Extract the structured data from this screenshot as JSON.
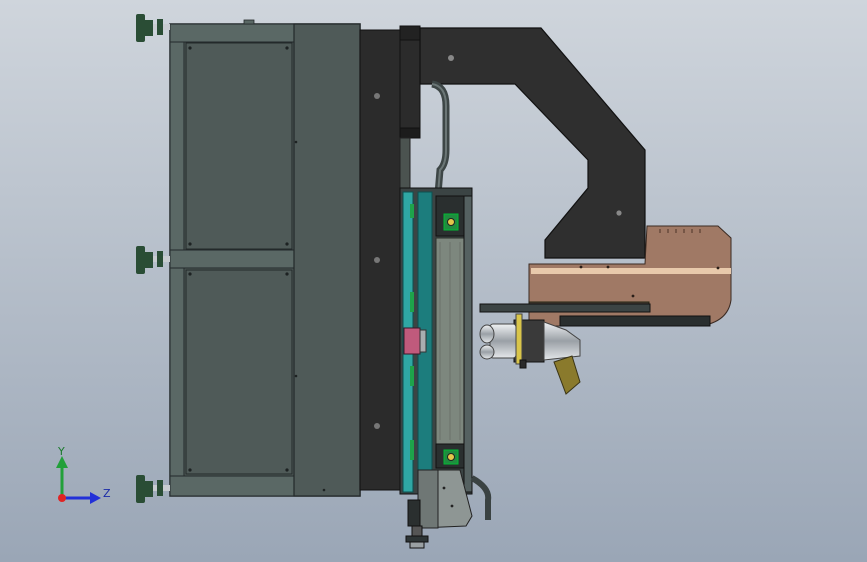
{
  "viewport": {
    "background_top": "#cfd5dc",
    "background_bottom": "#9aa6b6"
  },
  "colors": {
    "frame_dark": "#4f5a58",
    "frame_panel": "#5a6865",
    "frame_edge": "#23292a",
    "column_black": "#2b2b2b",
    "column_edge": "#111111",
    "arm_black": "#2f2f2f",
    "teal_rail": "#2fa7a4",
    "teal_dark": "#1c7d7d",
    "belt_grey": "#7d877e",
    "copper_head": "#a07965",
    "copper_stripe": "#e8c9ab",
    "foot_green": "#2a4d35",
    "chrome": "#c8ccd0",
    "mustard": "#8a7a2c",
    "triad_x": "#e02424",
    "triad_y": "#22a03a",
    "triad_z": "#2230d8"
  },
  "triad": {
    "y_label": "Y",
    "z_label": "Z"
  },
  "icons": {
    "coordinate_triad": "xyz-axis-triad-icon",
    "leveling_foot": "leveling-foot-icon",
    "bolt_hole": "bolt-hole-icon"
  }
}
